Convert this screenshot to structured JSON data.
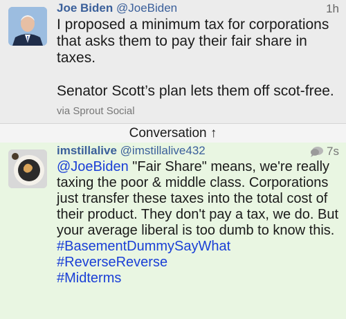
{
  "tweet": {
    "author_name": "Joe Biden",
    "author_handle": "@JoeBiden",
    "time": "1h",
    "line1": "I proposed a minimum tax for corporations that asks them to pay their fair share in taxes.",
    "line2": "Senator Scott’s plan lets them off scot-free.",
    "via": "via Sprout Social"
  },
  "conversation": {
    "label": "Conversation ↑"
  },
  "reply": {
    "author_name": "imstillalive",
    "author_handle": "@imstillalive432",
    "time": "7s",
    "mention": "@JoeBiden",
    "text": " \"Fair Share\" means, we're really taxing the poor & middle class. Corporations just transfer these taxes into the total cost of their product. They don't pay a tax, we do. But your average liberal is too dumb to know this.",
    "hashtags": [
      "#BasementDummySayWhat",
      "#ReverseReverse",
      "#Midterms"
    ]
  }
}
